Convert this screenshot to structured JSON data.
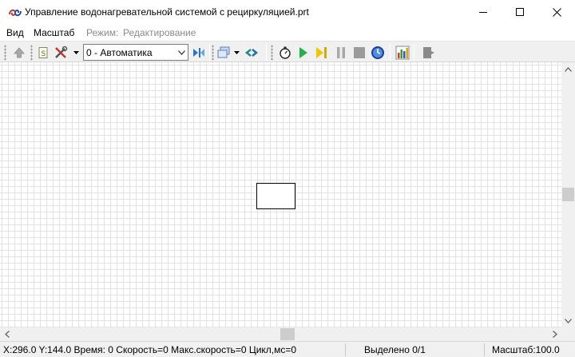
{
  "window": {
    "title": "Управление водонагревательной системой с рециркуляцией.prt"
  },
  "menu": {
    "items": [
      "Вид",
      "Масштаб"
    ],
    "mode_label": "Режим:",
    "mode_value": "Редактирование"
  },
  "toolbar": {
    "mode_select_value": "0 - Автоматика",
    "icons": [
      "up-arrow-icon",
      "script-icon",
      "tools-icon",
      "mode-select",
      "step-icon",
      "windows-icon",
      "link-icon",
      "timer-icon",
      "play-icon",
      "step-forward-icon",
      "pause-icon",
      "stop-icon",
      "clock-icon",
      "chart-icon",
      "exit-icon"
    ]
  },
  "status": {
    "coords_speed": "X:296.0  Y:144.0 Время: 0 Скорость=0 Макс.скорость=0 Цикл,мс=0",
    "selected": "Выделено 0/1",
    "scale": "Масштаб:100.0"
  },
  "colors": {
    "grid": "#e4e4e4",
    "toolbar_bg": "#f0f0f0",
    "play_green": "#22b24c",
    "step_yellow": "#f2c500"
  }
}
